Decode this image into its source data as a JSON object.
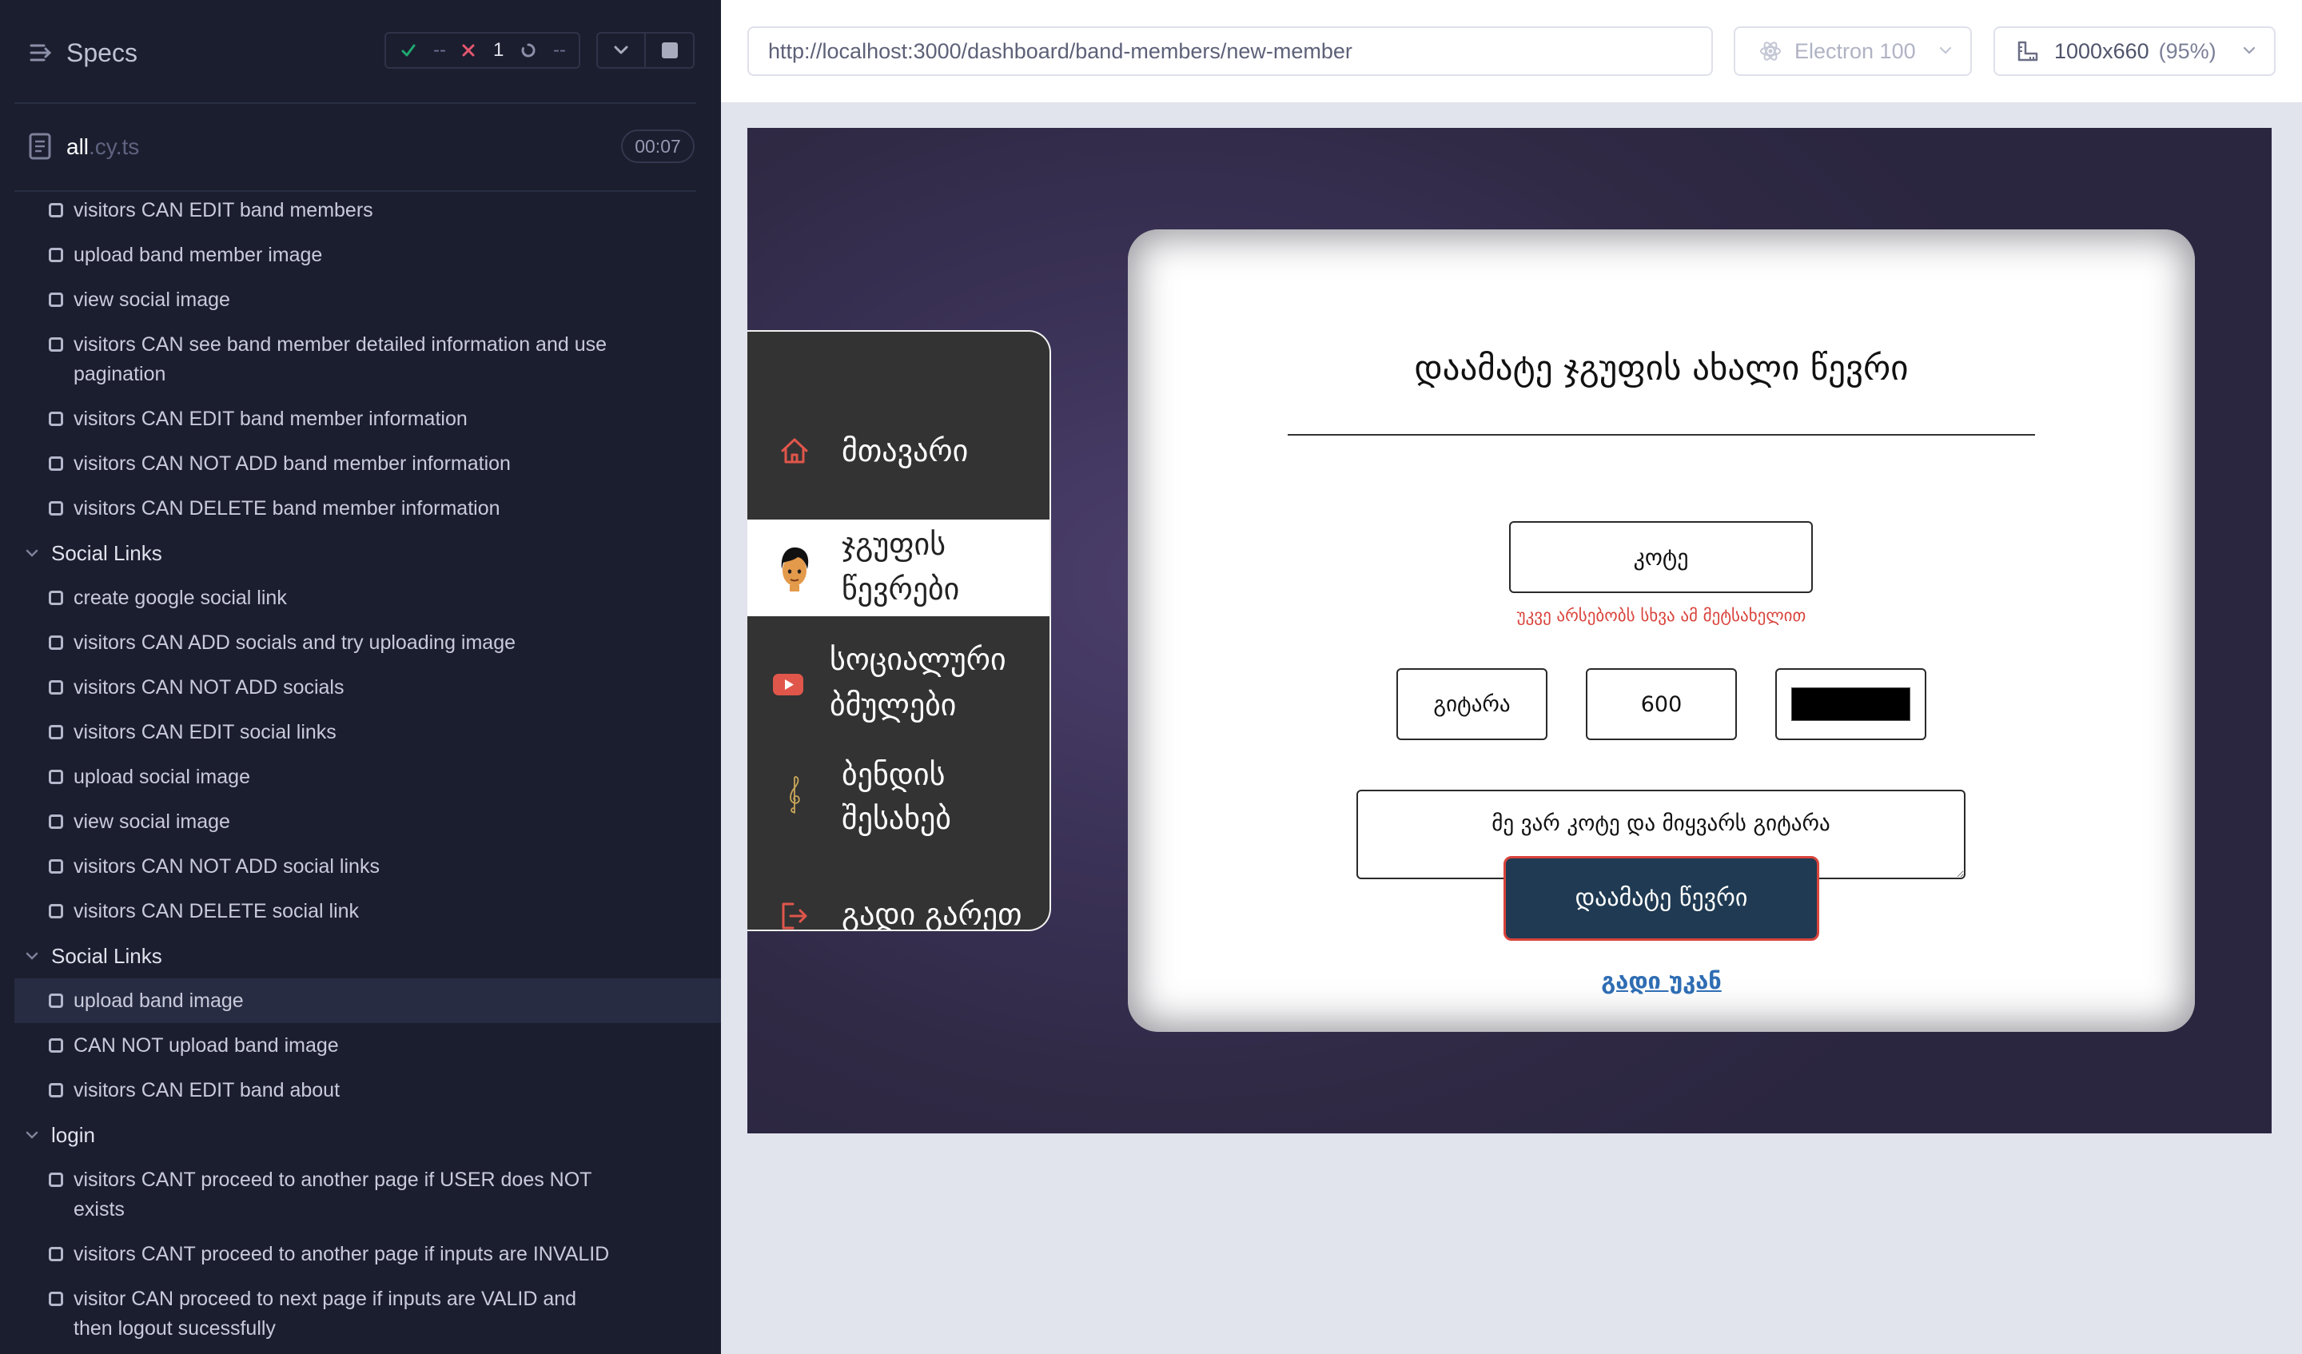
{
  "runner": {
    "specs_label": "Specs",
    "stats": {
      "passed": "--",
      "failed": "1",
      "pending": "--"
    },
    "spec_file": {
      "name": "all",
      "ext": ".cy.ts",
      "duration": "00:07"
    },
    "tests": [
      [
        "visitors CAN EDIT band members"
      ],
      [
        "upload band member image"
      ],
      [
        "view social image"
      ],
      [
        "visitors CAN see band member detailed information and use",
        "pagination"
      ],
      [
        "visitors CAN EDIT band member information"
      ],
      [
        "visitors CAN NOT ADD band member information"
      ],
      [
        "visitors CAN DELETE band member information"
      ]
    ],
    "groups": [
      {
        "title": "Social Links",
        "tests": [
          [
            "create google social link"
          ],
          [
            "visitors CAN ADD socials and try uploading image"
          ],
          [
            "visitors CAN NOT ADD socials"
          ],
          [
            "visitors CAN EDIT social links"
          ],
          [
            "upload social image"
          ],
          [
            "view social image"
          ],
          [
            "visitors CAN NOT ADD social links"
          ],
          [
            "visitors CAN DELETE social link"
          ]
        ]
      },
      {
        "title": "Social Links",
        "tests": [
          [
            "upload band image"
          ],
          [
            "CAN NOT upload band image"
          ],
          [
            "visitors CAN EDIT band about"
          ]
        ]
      },
      {
        "title": "login",
        "tests": [
          [
            "visitors CANT proceed to another page if USER does NOT",
            "exists"
          ],
          [
            "visitors CANT proceed to another page if inputs are INVALID"
          ],
          [
            "visitor CAN proceed to next page if inputs are VALID and",
            "then logout sucessfully"
          ]
        ]
      }
    ]
  },
  "browser_bar": {
    "url": "http://localhost:3000/dashboard/band-members/new-member",
    "browser": "Electron 100",
    "viewport": "1000x660",
    "zoom": "(95%)"
  },
  "app": {
    "nav": [
      {
        "icon": "home-icon",
        "lines": [
          "მთავარი"
        ]
      },
      {
        "icon": "member-avatar",
        "lines": [
          "ჯგუფის",
          "წევრები"
        ],
        "active": true
      },
      {
        "icon": "youtube-icon",
        "lines": [
          "სოციალური",
          "ბმულები"
        ]
      },
      {
        "icon": "treble-clef-icon",
        "lines": [
          "ბენდის",
          "შესახებ"
        ]
      },
      {
        "icon": "logout-icon",
        "lines": [
          "გადი გარეთ"
        ]
      }
    ],
    "form": {
      "title": "დაამატე ჯგუფის ახალი წევრი",
      "nickname": "კოტე",
      "nickname_error": "უკვე არსებობს სხვა ამ მეტსახელით",
      "instrument": "გიტარა",
      "number": "600",
      "color": "#000000",
      "bio": "მე ვარ კოტე და მიყვარს გიტარა",
      "submit_label": "დაამატე წევრი",
      "back_link": "გადი უკან"
    }
  },
  "colors": {
    "sidebar_bg": "#1b1e2e",
    "passed": "#1fa971",
    "failed": "#e45770",
    "error_text": "#d9433b",
    "submit_bg": "#1f3a52",
    "link": "#2f6db3"
  }
}
